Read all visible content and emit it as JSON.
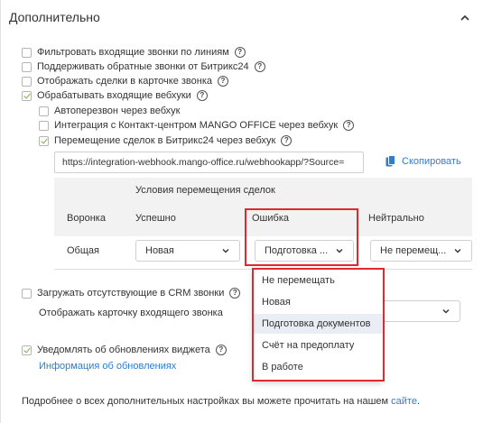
{
  "section": {
    "title": "Дополнительно"
  },
  "checkboxes": [
    {
      "label": "Фильтровать входящие звонки по линиям",
      "checked": false
    },
    {
      "label": "Поддерживать обратные звонки от Битрикс24",
      "checked": false
    },
    {
      "label": "Отображать сделки в карточке звонка",
      "checked": false
    },
    {
      "label": "Обрабатывать входящие вебхуки",
      "checked": true
    }
  ],
  "webhook_options": [
    {
      "label": "Автоперезвон через вебхук",
      "checked": false
    },
    {
      "label": "Интеграция с Контакт-центром MANGO OFFICE через вебхук",
      "checked": false
    },
    {
      "label": "Перемещение сделок в Битрикс24 через вебхук",
      "checked": true
    }
  ],
  "webhook": {
    "url": "https://integration-webhook.mango-office.ru/webhookapp/?Source=",
    "copy_label": "Скопировать"
  },
  "deal_table": {
    "group_header": "Условия перемещения сделок",
    "columns": [
      "Воронка",
      "Успешно",
      "Ошибка",
      "Нейтрально"
    ],
    "row": {
      "funnel": "Общая",
      "success": "Новая",
      "error": "Подготовка ...",
      "neutral": "Не перемещ..."
    }
  },
  "dropdown": {
    "options": [
      "Не перемещать",
      "Новая",
      "Подготовка документов",
      "Счёт на предоплату",
      "В работе"
    ],
    "selected_index": 2
  },
  "extra": {
    "load_missing_label": "Загружать отсутствующие в CRM звонки",
    "show_card_label": "Отображать карточку входящего звонка",
    "notify_label": "Уведомлять об обновлениях виджета",
    "updates_link": "Информация об обновлениях",
    "footer_text": "Подробнее о всех дополнительных настройках вы можете прочитать на нашем",
    "footer_link": "сайте",
    "footer_dot": "."
  },
  "colors": {
    "accent": "#2e7dd1",
    "highlight": "#e0282e",
    "check": "#7bb241"
  }
}
